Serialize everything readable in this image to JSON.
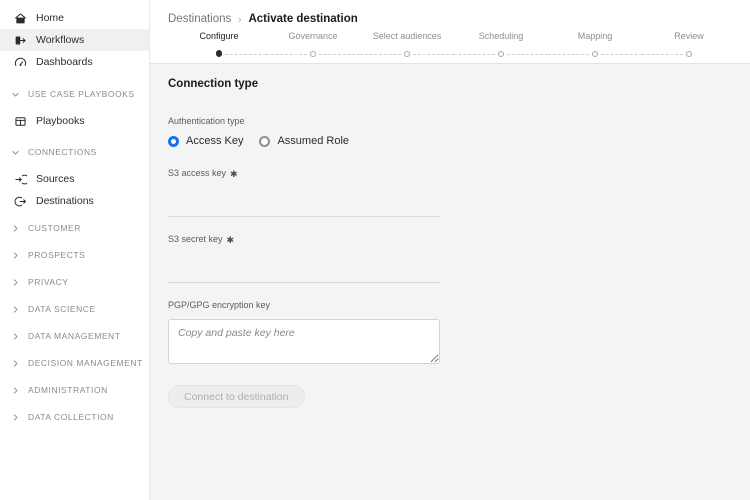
{
  "sidebar": {
    "primary_items": [
      {
        "label": "Home",
        "icon": "home-icon",
        "name": "home",
        "active": false
      },
      {
        "label": "Workflows",
        "icon": "workflows-icon",
        "name": "workflows",
        "active": true
      },
      {
        "label": "Dashboards",
        "icon": "dashboards-icon",
        "name": "dashboards",
        "active": false
      }
    ],
    "sections": [
      {
        "label": "USE CASE PLAYBOOKS",
        "name": "use-case-playbooks",
        "expanded": true,
        "items": [
          {
            "label": "Playbooks",
            "icon": "playbooks-icon",
            "name": "playbooks"
          }
        ]
      },
      {
        "label": "CONNECTIONS",
        "name": "connections",
        "expanded": true,
        "items": [
          {
            "label": "Sources",
            "icon": "sources-icon",
            "name": "sources"
          },
          {
            "label": "Destinations",
            "icon": "destinations-icon",
            "name": "destinations"
          }
        ]
      },
      {
        "label": "CUSTOMER",
        "name": "customer",
        "expanded": false,
        "items": []
      },
      {
        "label": "PROSPECTS",
        "name": "prospects",
        "expanded": false,
        "items": []
      },
      {
        "label": "PRIVACY",
        "name": "privacy",
        "expanded": false,
        "items": []
      },
      {
        "label": "DATA SCIENCE",
        "name": "data-science",
        "expanded": false,
        "items": []
      },
      {
        "label": "DATA MANAGEMENT",
        "name": "data-management",
        "expanded": false,
        "items": []
      },
      {
        "label": "DECISION MANAGEMENT",
        "name": "decision-management",
        "expanded": false,
        "items": []
      },
      {
        "label": "ADMINISTRATION",
        "name": "administration",
        "expanded": false,
        "items": []
      },
      {
        "label": "DATA COLLECTION",
        "name": "data-collection",
        "expanded": false,
        "items": []
      }
    ]
  },
  "breadcrumb": {
    "parent": "Destinations",
    "separator": "›",
    "current": "Activate destination"
  },
  "stepper": {
    "current_index": 0,
    "steps": [
      {
        "label": "Configure"
      },
      {
        "label": "Governance"
      },
      {
        "label": "Select audiences"
      },
      {
        "label": "Scheduling"
      },
      {
        "label": "Mapping"
      },
      {
        "label": "Review"
      }
    ]
  },
  "form": {
    "section_title": "Connection type",
    "auth": {
      "label": "Authentication type",
      "selected": "Access Key",
      "options": [
        {
          "label": "Access Key",
          "selected": true
        },
        {
          "label": "Assumed Role",
          "selected": false
        }
      ]
    },
    "access_key": {
      "label": "S3 access key",
      "required_marker": "✱",
      "value": "",
      "placeholder": ""
    },
    "secret_key": {
      "label": "S3 secret key",
      "required_marker": "✱",
      "value": "",
      "placeholder": ""
    },
    "pgp_key": {
      "label": "PGP/GPG encryption key",
      "value": "",
      "placeholder": "Copy and paste key here"
    },
    "submit": {
      "label": "Connect to destination",
      "disabled": true
    }
  },
  "colors": {
    "accent_blue": "#1473E6",
    "main_background": "#F4F4F4",
    "sidebar_background": "#FFFFFF",
    "active_nav_background": "#F0F0F0",
    "text_primary": "#1B1B1B",
    "text_muted": "#8E8E8E"
  }
}
